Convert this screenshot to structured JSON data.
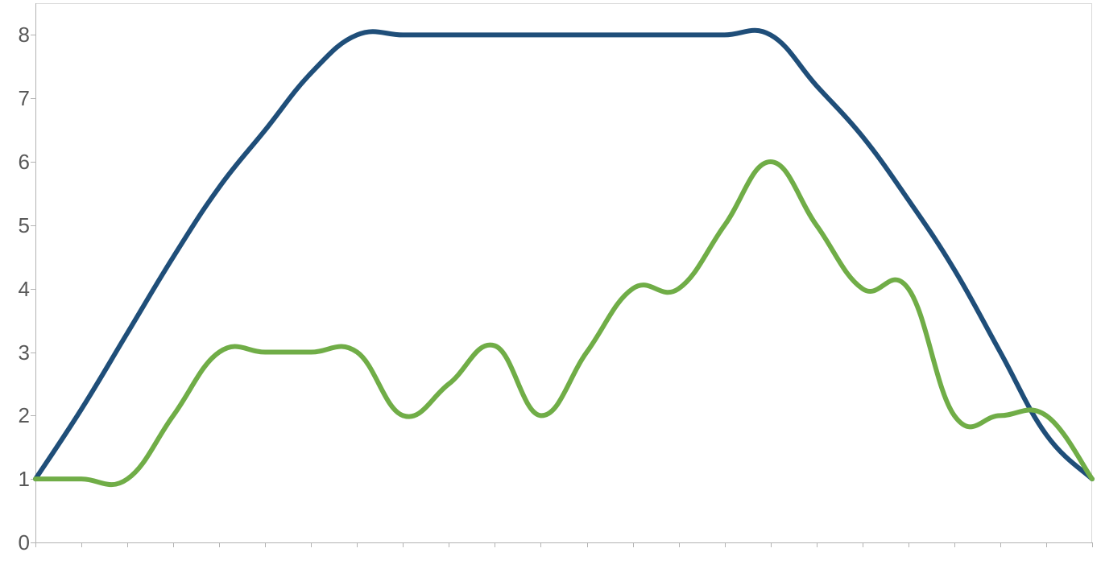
{
  "chart_data": {
    "type": "line",
    "ylim": [
      0,
      8.5
    ],
    "y_ticks": [
      0,
      1,
      2,
      3,
      4,
      5,
      6,
      7,
      8
    ],
    "x_count": 23,
    "x": [
      0,
      1,
      2,
      3,
      4,
      5,
      6,
      7,
      8,
      9,
      10,
      11,
      12,
      13,
      14,
      15,
      16,
      17,
      18,
      19,
      20,
      21,
      22
    ],
    "series": [
      {
        "name": "series-blue",
        "color": "#1f4e79",
        "stroke_width": 6,
        "values": [
          1.0,
          2.1,
          3.3,
          4.5,
          5.6,
          6.5,
          7.4,
          8.0,
          8.0,
          8.0,
          8.0,
          8.0,
          8.0,
          8.0,
          8.0,
          8.0,
          8.0,
          7.2,
          6.4,
          5.4,
          4.3,
          3.0,
          1.7,
          1.0
        ]
      },
      {
        "name": "series-green",
        "color": "#70ad47",
        "stroke_width": 6,
        "values": [
          1.0,
          1.0,
          1.0,
          2.0,
          3.0,
          3.0,
          3.0,
          3.0,
          2.0,
          2.5,
          3.1,
          2.0,
          3.0,
          4.0,
          4.0,
          5.0,
          6.0,
          5.0,
          4.0,
          4.0,
          2.0,
          2.0,
          2.0,
          1.0
        ]
      }
    ],
    "title": "",
    "xlabel": "",
    "ylabel": ""
  },
  "colors": {
    "axis": "#b3b3b3",
    "border": "#d9d9d9",
    "text": "#595959"
  }
}
